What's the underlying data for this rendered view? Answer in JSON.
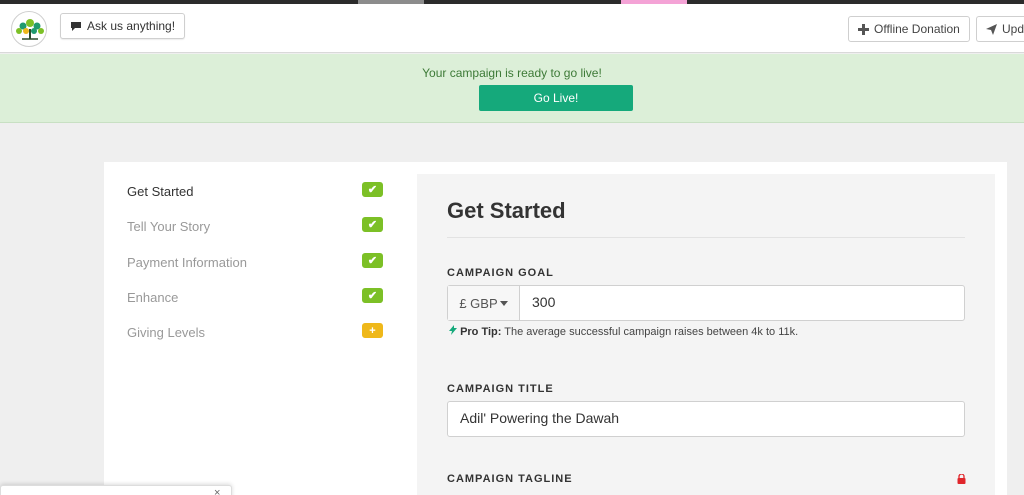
{
  "header": {
    "ask_label": "Ask us anything!",
    "offline_label": "Offline Donation",
    "update_label": "Upda"
  },
  "banner": {
    "message": "Your campaign is ready to go live!",
    "golive_label": "Go Live!"
  },
  "nav": {
    "items": [
      {
        "label": "Get Started",
        "status": "✔"
      },
      {
        "label": "Tell Your Story",
        "status": "✔"
      },
      {
        "label": "Payment Information",
        "status": "✔"
      },
      {
        "label": "Enhance",
        "status": "✔"
      },
      {
        "label": "Giving Levels",
        "status": "+"
      }
    ]
  },
  "form": {
    "title": "Get Started",
    "goal_label": "CAMPAIGN GOAL",
    "currency": "£ GBP",
    "goal_value": "300",
    "protip_label": "Pro Tip:",
    "protip_text": " The average successful campaign raises between 4k to 11k.",
    "title_label": "CAMPAIGN TITLE",
    "title_value": "Adil' Powering the Dawah",
    "tagline_label": "CAMPAIGN TAGLINE"
  },
  "popup": {
    "close": "×"
  },
  "colors": {
    "accent": "#15a97b",
    "check": "#7cc026",
    "pending": "#efb81a",
    "banner_bg": "#dcefd8",
    "lock": "#e0262b"
  }
}
